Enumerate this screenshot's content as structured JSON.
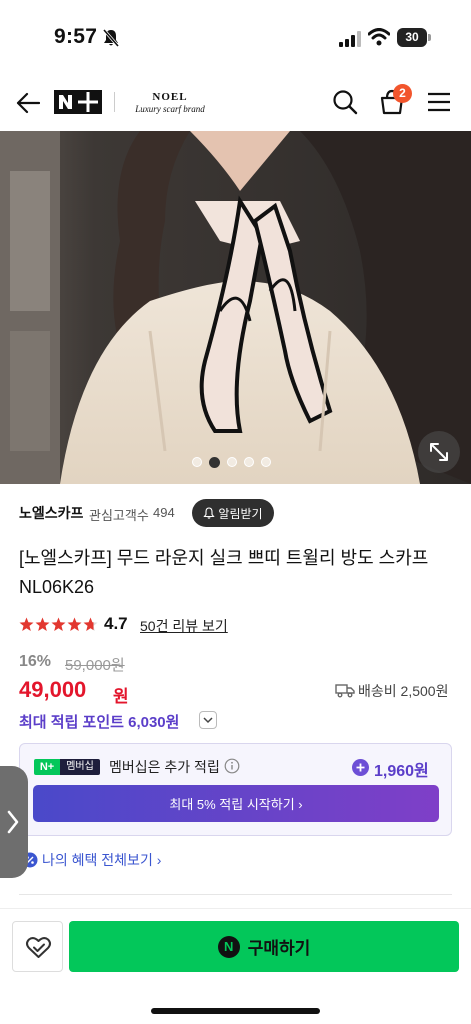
{
  "status_bar": {
    "time": "9:57",
    "battery": "30"
  },
  "header": {
    "np_logo": "N+",
    "brand_name": "NOEL",
    "brand_tagline": "Luxury scarf brand",
    "cart_count": "2"
  },
  "gallery": {
    "slide_count": 5,
    "active_slide": 1
  },
  "store": {
    "name": "노엘스카프",
    "follower_label": "관심고객수",
    "follower_count": "494",
    "notify_label": "알림받기"
  },
  "product": {
    "title": "[노엘스카프] 무드 라운지 실크 쁘띠 트윌리 방도 스카프 NL06K26",
    "rating": "4.7",
    "review_link": "50건 리뷰 보기",
    "discount": "16%",
    "original_price": "59,000원",
    "sale_price": "49,000",
    "sale_unit": "원",
    "shipping": "배송비 2,500원",
    "points_label": "최대 적립 포인트",
    "points_value": "6,030원"
  },
  "membership": {
    "badge_logo": "N+",
    "badge_text": "멤버십",
    "text": "멤버십은 추가 적립",
    "points": "1,960원",
    "start_button": "최대 5% 적립 시작하기 ›"
  },
  "benefits_link": "나의 혜택 전체보기 ›",
  "bottom_bar": {
    "buy_icon": "N",
    "buy_label": "구매하기"
  },
  "colors": {
    "accent_red": "#e3162c",
    "purple": "#5b3ec9",
    "naver_green": "#03c75a"
  }
}
